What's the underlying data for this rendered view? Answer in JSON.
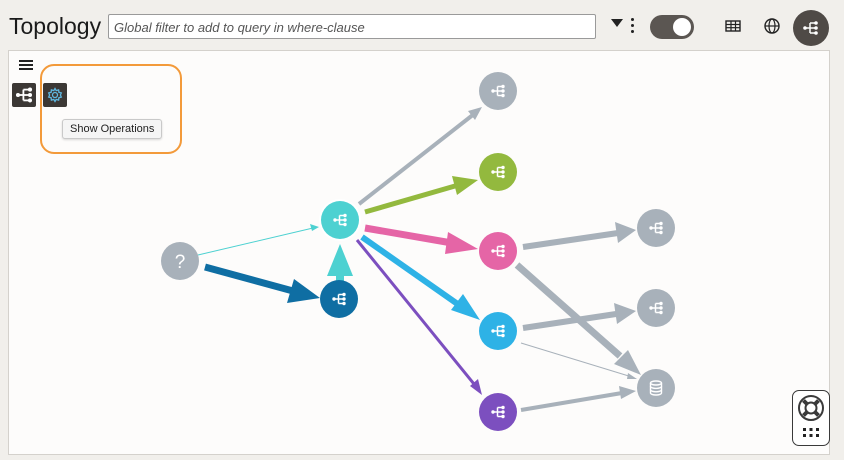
{
  "header": {
    "title": "Topology",
    "filter_placeholder": "Global filter to add to query in where-clause",
    "toggle_on": true
  },
  "toolbar": {
    "tooltip": "Show Operations"
  },
  "icons": {
    "menu": "hamburger-icon",
    "service": "service-icon",
    "operations": "gear-icon",
    "table": "table-icon",
    "globe": "globe-icon",
    "database": "database-icon",
    "help": "lifebuoy-icon",
    "apps": "grid-icon",
    "unknown": "question-icon"
  },
  "colors": {
    "accent_border": "#f39a3a",
    "unknown": "#a8b1ba",
    "gray": "#a8b1ba",
    "teal": "#4dd1d1",
    "navy": "#0f6ea3",
    "green": "#93b93e",
    "pink": "#e565a6",
    "cyan": "#2eb2e6",
    "purple": "#7c4fbf"
  },
  "graph": {
    "nodes": [
      {
        "id": "unknown",
        "kind": "unknown",
        "color": "#a8b1ba",
        "label": "?"
      },
      {
        "id": "central",
        "kind": "service",
        "color": "#4dd1d1"
      },
      {
        "id": "navy",
        "kind": "service",
        "color": "#0f6ea3"
      },
      {
        "id": "gray-top",
        "kind": "service",
        "color": "#a8b1ba"
      },
      {
        "id": "green",
        "kind": "service",
        "color": "#93b93e"
      },
      {
        "id": "pink",
        "kind": "service",
        "color": "#e565a6"
      },
      {
        "id": "cyan",
        "kind": "service",
        "color": "#2eb2e6"
      },
      {
        "id": "purple",
        "kind": "service",
        "color": "#7c4fbf"
      },
      {
        "id": "gray-right-1",
        "kind": "service",
        "color": "#a8b1ba"
      },
      {
        "id": "gray-right-2",
        "kind": "service",
        "color": "#a8b1ba"
      },
      {
        "id": "database",
        "kind": "database",
        "color": "#a8b1ba"
      }
    ],
    "edges": [
      {
        "from": "unknown",
        "to": "central",
        "color": "#4dd1d1",
        "weight": 1
      },
      {
        "from": "unknown",
        "to": "navy",
        "color": "#0f6ea3",
        "weight": 6
      },
      {
        "from": "navy",
        "to": "central",
        "color": "#4dd1d1",
        "weight": 8
      },
      {
        "from": "central",
        "to": "gray-top",
        "color": "#a8b1ba",
        "weight": 4
      },
      {
        "from": "central",
        "to": "green",
        "color": "#93b93e",
        "weight": 5
      },
      {
        "from": "central",
        "to": "pink",
        "color": "#e565a6",
        "weight": 7
      },
      {
        "from": "central",
        "to": "cyan",
        "color": "#2eb2e6",
        "weight": 6
      },
      {
        "from": "central",
        "to": "purple",
        "color": "#7c4fbf",
        "weight": 3
      },
      {
        "from": "pink",
        "to": "gray-right-1",
        "color": "#a8b1ba",
        "weight": 6
      },
      {
        "from": "pink",
        "to": "database",
        "color": "#a8b1ba",
        "weight": 7
      },
      {
        "from": "cyan",
        "to": "gray-right-2",
        "color": "#a8b1ba",
        "weight": 6
      },
      {
        "from": "cyan",
        "to": "database",
        "color": "#a8b1ba",
        "weight": 1
      },
      {
        "from": "purple",
        "to": "database",
        "color": "#a8b1ba",
        "weight": 4
      }
    ]
  }
}
